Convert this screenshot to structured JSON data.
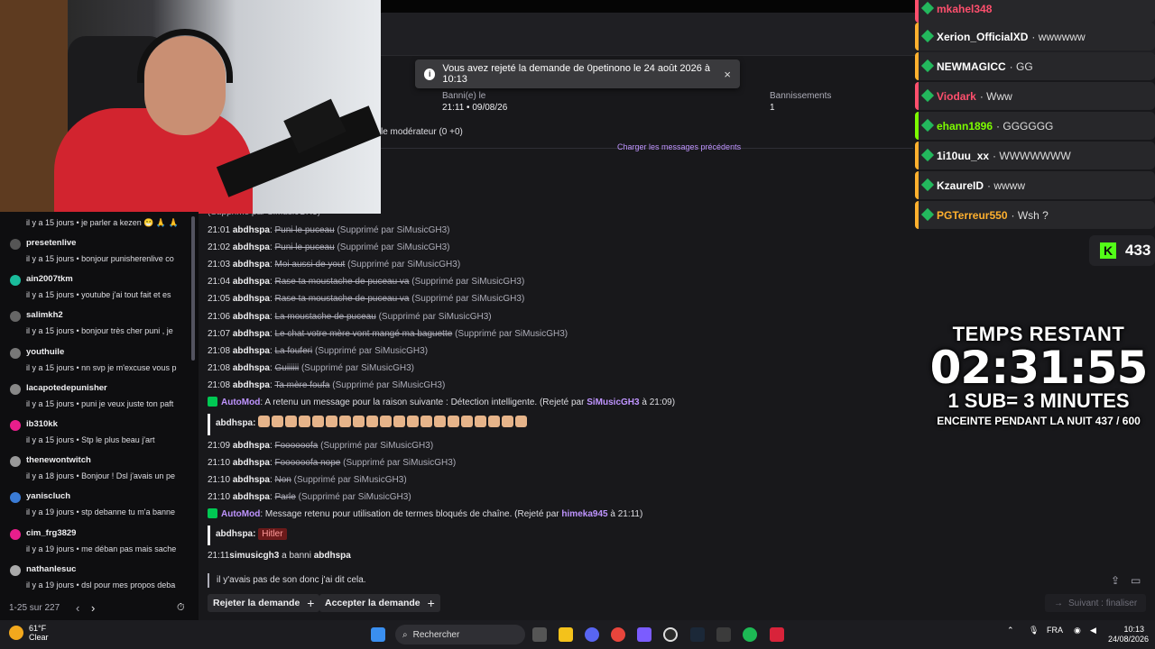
{
  "toast": {
    "text": "Vous avez rejeté la demande de 0petinono le 24 août 2026 à 10:13",
    "close": "×"
  },
  "header": {
    "banned_label": "Banni(e) le",
    "banned_value": "21:11 • 09/08/26",
    "bans_label": "Bannissements",
    "bans_value": "1",
    "moderator_line": "le modérateur (0 +0)",
    "load_previous": "Charger les messages précédents"
  },
  "messages": [
    {
      "time": "",
      "user": "",
      "text": "",
      "note": "par SiMusicGH3)"
    },
    {
      "time": "",
      "user": "",
      "text": "",
      "note": "par SiMusicGH3)"
    },
    {
      "time": "",
      "user": "",
      "text": "",
      "note": "(Supprimé par SiMusicGH3)"
    },
    {
      "time": "21:01",
      "user": "abdhspa",
      "text": "Puni le puceau",
      "note": "(Supprimé par SiMusicGH3)"
    },
    {
      "time": "21:02",
      "user": "abdhspa",
      "text": "Puni le puceau",
      "note": "(Supprimé par SiMusicGH3)"
    },
    {
      "time": "21:03",
      "user": "abdhspa",
      "text": "Moi aussi de yout",
      "note": "(Supprimé par SiMusicGH3)"
    },
    {
      "time": "21:04",
      "user": "abdhspa",
      "text": "Rase ta moustache de puceau va",
      "note": "(Supprimé par SiMusicGH3)"
    },
    {
      "time": "21:05",
      "user": "abdhspa",
      "text": "Rase ta moustache de puceau va",
      "note": "(Supprimé par SiMusicGH3)"
    },
    {
      "time": "21:06",
      "user": "abdhspa",
      "text": "La moustache de puceau",
      "note": "(Supprimé par SiMusicGH3)"
    },
    {
      "time": "21:07",
      "user": "abdhspa",
      "text": "Le chat votre mère vont mangé ma baguette",
      "note": "(Supprimé par SiMusicGH3)"
    },
    {
      "time": "21:08",
      "user": "abdhspa",
      "text": "La fouferi",
      "note": "(Supprimé par SiMusicGH3)"
    },
    {
      "time": "21:08",
      "user": "abdhspa",
      "text": "Guiiiiii",
      "note": "(Supprimé par SiMusicGH3)"
    },
    {
      "time": "21:08",
      "user": "abdhspa",
      "text": "Ta mère foufa",
      "note": "(Supprimé par SiMusicGH3)"
    }
  ],
  "automod1": {
    "name": "AutoMod",
    "text": ": A retenu un message pour la raison suivante : Détection intelligente. (Rejeté par",
    "by": "SiMusicGH3",
    "at": "à 21:09)",
    "quote_user": "abdhspa:"
  },
  "messages2": [
    {
      "time": "21:09",
      "user": "abdhspa",
      "text": "Foooooofa",
      "note": "(Supprimé par SiMusicGH3)"
    },
    {
      "time": "21:10",
      "user": "abdhspa",
      "text": "Foooooofa nope",
      "note": "(Supprimé par SiMusicGH3)"
    },
    {
      "time": "21:10",
      "user": "abdhspa",
      "text": "Non",
      "note": "(Supprimé par SiMusicGH3)"
    },
    {
      "time": "21:10",
      "user": "abdhspa",
      "text": "Parle",
      "note": "(Supprimé par SiMusicGH3)"
    }
  ],
  "automod2": {
    "name": "AutoMod",
    "text": ": Message retenu pour utilisation de termes bloqués de chaîne. (Rejeté par",
    "by": "himeka945",
    "at": "à 21:11)",
    "quote_user": "abdhspa:",
    "quote_text": "Hitler"
  },
  "ban_line": {
    "time": "21:11",
    "mod": "simusicgh3",
    "middle": "a banni",
    "user": "abdhspa"
  },
  "reply_text": "il y'avais pas de son donc j'ai dit cela.",
  "actions": {
    "reject": "Rejeter la demande",
    "accept": "Accepter la demande",
    "next": "Suivant : finaliser"
  },
  "left_list": [
    {
      "name": "",
      "text": "il y a 15 jours • je parler a kezen 😁 🙏 🙏",
      "color": "#6441a5"
    },
    {
      "name": "presetenlive",
      "text": "il y a 15 jours • bonjour punisherenlive co",
      "color": "#555"
    },
    {
      "name": "ain2007tkm",
      "text": "il y a 15 jours • youtube j'ai tout fait et es",
      "color": "#1abc9c"
    },
    {
      "name": "salimkh2",
      "text": "il y a 15 jours • bonjour très cher puni , je",
      "color": "#666"
    },
    {
      "name": "youthuile",
      "text": "il y a 15 jours • nn svp je m'excuse vous p",
      "color": "#777"
    },
    {
      "name": "lacapotedepunisher",
      "text": "il y a 15 jours • puni je veux juste ton paft",
      "color": "#888"
    },
    {
      "name": "ib310kk",
      "text": "il y a 15 jours • Stp le plus beau j'art",
      "color": "#e91e8c"
    },
    {
      "name": "thenewontwitch",
      "text": "il y a 18 jours • Bonjour ! Dsl j'avais un pe",
      "color": "#999"
    },
    {
      "name": "yaniscluch",
      "text": "il y a 19 jours • stp debanne tu m'a banne",
      "color": "#3a7bd5"
    },
    {
      "name": "cim_frg3829",
      "text": "il y a 19 jours • me déban pas mais sache",
      "color": "#e91e8c"
    },
    {
      "name": "nathanlesuc",
      "text": "il y a 19 jours • dsl pour mes propos deba",
      "color": "#aaa"
    }
  ],
  "pagination": {
    "text": "1-25 sur 227",
    "prev": "‹",
    "next": "›"
  },
  "right_chat": [
    {
      "user": "mkahel348",
      "msg": "",
      "color": "#ff4f6d"
    },
    {
      "user": "Xerion_OfficialXD",
      "msg": "· wwwwww",
      "color": "#ffffff"
    },
    {
      "user": "NEWMAGICC",
      "msg": "· GG",
      "color": "#ffffff"
    },
    {
      "user": "Viodark",
      "msg": "· Www",
      "color": "#ff4f6d"
    },
    {
      "user": "ehann1896",
      "msg": "· GGGGGG",
      "color": "#7cfc00"
    },
    {
      "user": "1i10uu_xx",
      "msg": "· WWWWWWW",
      "color": "#ffffff"
    },
    {
      "user": "KzaureID",
      "msg": "· wwww",
      "color": "#ffffff"
    },
    {
      "user": "PGTerreur550",
      "msg": "· Wsh ?",
      "color": "#ffb02e"
    }
  ],
  "kick": {
    "logo": "K",
    "count": "433"
  },
  "overlay": {
    "line1": "TEMPS RESTANT",
    "timer": "02:31:55",
    "line3": "1 SUB= 3 MINUTES",
    "line4": "ENCEINTE PENDANT LA NUIT 437 / 600"
  },
  "taskbar": {
    "temp": "61°F",
    "weather": "Clear",
    "search": "Rechercher",
    "lang": "FRA",
    "time": "10:13",
    "date": "24/08/2026"
  }
}
